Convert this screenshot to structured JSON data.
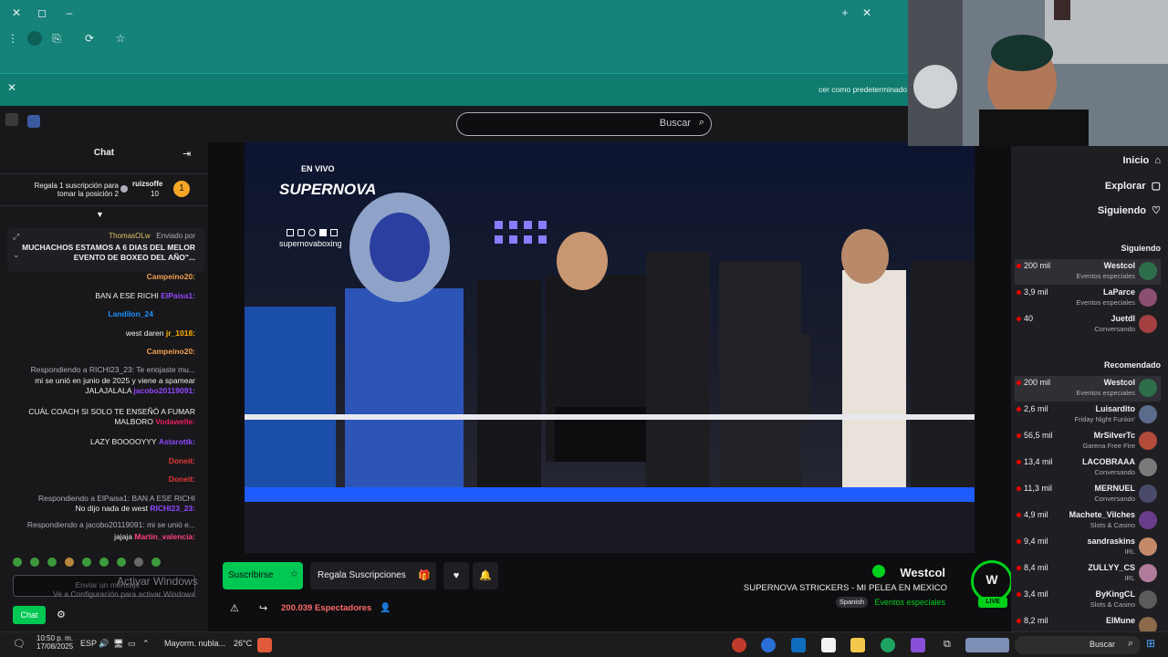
{
  "browser": {
    "infobar_text": "cer como predeterminado",
    "infobar_close": "✕"
  },
  "topnav": {
    "search_label": "Buscar"
  },
  "chat": {
    "title": "Chat",
    "pinned": {
      "text": "Regala 1 suscripción para tomar la posición 2",
      "user": "ruizsoffe",
      "count": "10"
    },
    "highlight": {
      "sent_by": "Enviado por",
      "sender": "ThomasOLw",
      "message": "MUCHACHOS ESTAMOS A 6 DIAS DEL MELOR EVENTO DE BOXEO DEL AÑO\"..."
    },
    "messages": [
      {
        "user": "Campeino20:",
        "text": ""
      },
      {
        "user": "ElPaisa1:",
        "text": "BAN A ESE RICHI"
      },
      {
        "user": "Landilon_24",
        "text": ""
      },
      {
        "user": "jr_1018:",
        "text": "west daren"
      },
      {
        "user": "Campeino20:",
        "text": ""
      },
      {
        "user": "",
        "text": "Respondiendo a RICHI23_23: Te enojaste mu..."
      },
      {
        "user": "jacobo20119091:",
        "text": "mi se unió en junio de 2025 y viene a spamear JALAJALALA"
      },
      {
        "user": "Vodawelle:",
        "text": "CUÁL COACH SI SOLO TE ENSEÑÓ A FUMAR MALBORO"
      },
      {
        "user": "Astarottk:",
        "text": "LAZY BOOOOYYY"
      },
      {
        "user": "Doneit:",
        "text": ""
      },
      {
        "user": "Doneit:",
        "text": ""
      },
      {
        "user": "",
        "text": "Respondiendo a ElPaisa1: BAN A ESE RICHI"
      },
      {
        "user": "RICHI23_23:",
        "text": "No dijo nada de west"
      },
      {
        "user": "",
        "text": "Respondiendo a jacobo20119091: mi se unió e..."
      },
      {
        "user": "Martin_valencia:",
        "text": "jajaja"
      }
    ],
    "activate_windows_title": "Activar Windows",
    "activate_windows_sub": "Ve a Configuración para activar Windows.",
    "input_placeholder": "Enviar un mensaje",
    "send_label": "Chat"
  },
  "video": {
    "overlay_live": "EN VIVO",
    "overlay_brand": "SUPERNOVA",
    "overlay_handle": "supernovaboxing"
  },
  "channel": {
    "name": "Westcol",
    "title": "SUPERNOVA STRICKERS - MI PELEA EN MEXICO",
    "category": "Eventos especiales",
    "tag": "Spanish",
    "live_badge": "LIVE",
    "viewers": "200.039 Espectadores",
    "subscribe_label": "Suscribirse",
    "gift_label": "Regala Suscripciones"
  },
  "sidebar": {
    "nav": [
      {
        "label": "Inicio"
      },
      {
        "label": "Explorar"
      },
      {
        "label": "Siguiendo"
      }
    ],
    "following_header": "Siguiendo",
    "following": [
      {
        "name": "Westcol",
        "category": "Eventos especiales",
        "viewers": "200 mil",
        "color": "#2d6e4a"
      },
      {
        "name": "LaParce",
        "category": "Eventos especiales",
        "viewers": "3,9 mil",
        "color": "#8c4f70"
      },
      {
        "name": "Juetdl",
        "category": "Conversando",
        "viewers": "40",
        "color": "#a34040"
      }
    ],
    "recommended_header": "Recomendado",
    "recommended": [
      {
        "name": "Westcol",
        "category": "Eventos especiales",
        "viewers": "200 mil",
        "color": "#2d6e4a"
      },
      {
        "name": "Luisardito",
        "category": "Friday Night Funkin'",
        "viewers": "2,6 mil",
        "color": "#5a6b8c"
      },
      {
        "name": "MrSilverTc",
        "category": "Garena Free Fire",
        "viewers": "56,5 mil",
        "color": "#b34b3b"
      },
      {
        "name": "LACOBRAAA",
        "category": "Conversando",
        "viewers": "13,4 mil",
        "color": "#7a7a7a"
      },
      {
        "name": "MERNUEL",
        "category": "Conversando",
        "viewers": "11,3 mil",
        "color": "#4a4a6a"
      },
      {
        "name": "Machete_Vilches",
        "category": "Slots & Casino",
        "viewers": "4,9 mil",
        "color": "#6a3c8c"
      },
      {
        "name": "sandraskins",
        "category": "IRL",
        "viewers": "9,4 mil",
        "color": "#c48a6a"
      },
      {
        "name": "ZULLYY_CS",
        "category": "IRL",
        "viewers": "8,4 mil",
        "color": "#b07a9a"
      },
      {
        "name": "ByKingCL",
        "category": "Slots & Casino",
        "viewers": "3,4 mil",
        "color": "#5c5c5c"
      },
      {
        "name": "ElMune",
        "category": "",
        "viewers": "8,2 mil",
        "color": "#8c6a4a"
      }
    ]
  },
  "taskbar": {
    "search_label": "Buscar",
    "weather_temp": "26°C",
    "weather_text": "Mayorm. nubla...",
    "lang": "ESP",
    "time": "10:50 p. m.",
    "date": "17/08/2025"
  },
  "colors": {
    "twitch_purple": "#9147ff",
    "live_red": "#eb0400",
    "green": "#00c853",
    "subscribe_green": "#00d11a"
  }
}
